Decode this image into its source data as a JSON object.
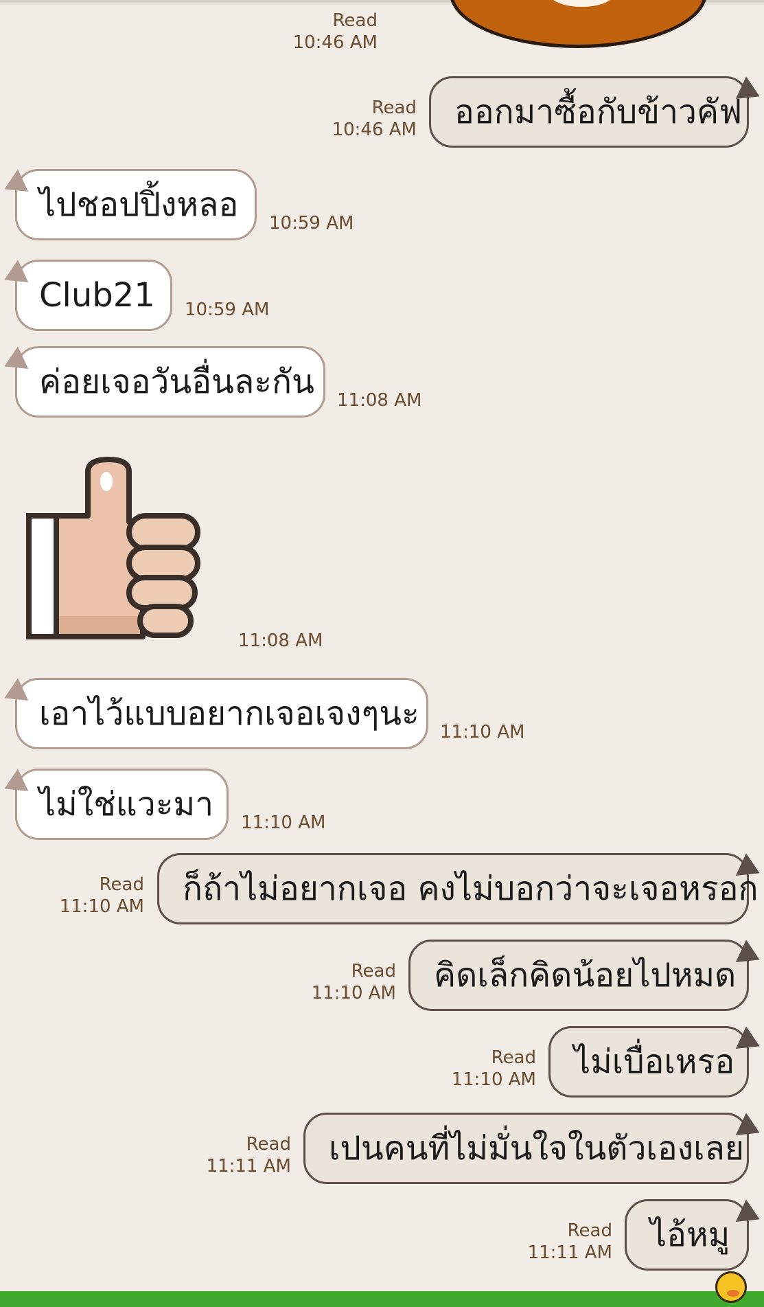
{
  "messages": [
    {
      "side": "out",
      "type": "sticker",
      "name": "donut",
      "read": "Read",
      "time": "10:46 AM"
    },
    {
      "side": "out",
      "type": "text",
      "text": "ออกมาซื้อกับข้าวคัฟ",
      "read": "Read",
      "time": "10:46 AM"
    },
    {
      "side": "in",
      "type": "text",
      "text": "ไปชอปปิ้งหลอ",
      "time": "10:59 AM"
    },
    {
      "side": "in",
      "type": "text",
      "text": "Club21",
      "time": "10:59 AM"
    },
    {
      "side": "in",
      "type": "text",
      "text": "ค่อยเจอวันอื่นละกัน",
      "time": "11:08 AM"
    },
    {
      "side": "in",
      "type": "sticker",
      "name": "thumbs-up",
      "time": "11:08 AM"
    },
    {
      "side": "in",
      "type": "text",
      "text": "เอาไว้แบบอยากเจอเจงๆนะ",
      "time": "11:10 AM"
    },
    {
      "side": "in",
      "type": "text",
      "text": "ไม่ใช่แวะมา",
      "time": "11:10 AM"
    },
    {
      "side": "out",
      "type": "text",
      "text": "ก็ถ้าไม่อยากเจอ คงไม่บอกว่าจะเจอหรอก",
      "read": "Read",
      "time": "11:10 AM"
    },
    {
      "side": "out",
      "type": "text",
      "text": "คิดเล็กคิดน้อยไปหมด",
      "read": "Read",
      "time": "11:10 AM"
    },
    {
      "side": "out",
      "type": "text",
      "text": "ไม่เบื่อเหรอ",
      "read": "Read",
      "time": "11:10 AM"
    },
    {
      "side": "out",
      "type": "text",
      "text": "เปนคนที่ไม่มั่นใจในตัวเองเลย",
      "read": "Read",
      "time": "11:11 AM"
    },
    {
      "side": "out",
      "type": "text",
      "text": "ไอ้หมู",
      "read": "Read",
      "time": "11:11 AM"
    }
  ],
  "colors": {
    "background": "#f1ece6",
    "incoming_bubble": "#ffffff",
    "outgoing_bubble": "#ebe4da",
    "timestamp": "#6b4c2e",
    "bottom_bar": "#3faa2e"
  }
}
